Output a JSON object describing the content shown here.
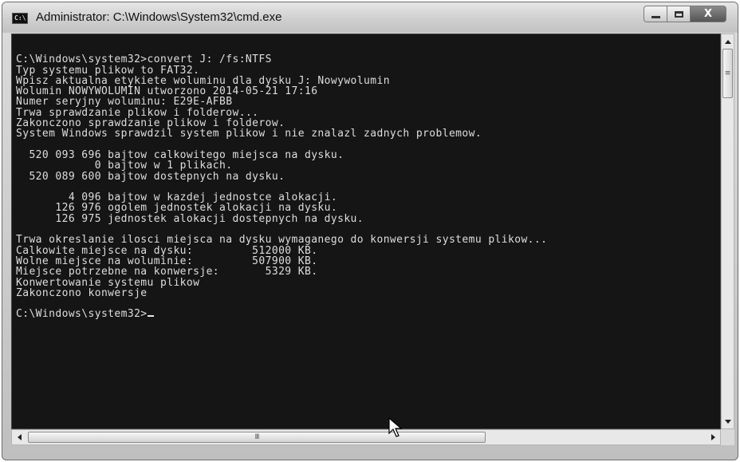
{
  "window": {
    "title": "Administrator: C:\\Windows\\System32\\cmd.exe",
    "icon": "cmd-icon",
    "controls": [
      "minimize-icon",
      "maximize-icon",
      "close-icon"
    ],
    "close_glyph": "X"
  },
  "console": {
    "lines": [
      "",
      "C:\\Windows\\system32>convert J: /fs:NTFS",
      "Typ systemu plikow to FAT32.",
      "Wpisz aktualna etykiete woluminu dla dysku J: Nowywolumin",
      "Wolumin NOWYWOLUMIN utworzono 2014-05-21 17:16",
      "Numer seryjny woluminu: E29E-AFBB",
      "Trwa sprawdzanie plikow i folderow...",
      "Zakonczono sprawdzanie plikow i folderow.",
      "System Windows sprawdzil system plikow i nie znalazl zadnych problemow.",
      "",
      "  520 093 696 bajtow calkowitego miejsca na dysku.",
      "            0 bajtow w 1 plikach.",
      "  520 089 600 bajtow dostepnych na dysku.",
      "",
      "        4 096 bajtow w kazdej jednostce alokacji.",
      "      126 976 ogolem jednostek alokacji na dysku.",
      "      126 975 jednostek alokacji dostepnych na dysku.",
      "",
      "Trwa okreslanie ilosci miejsca na dysku wymaganego do konwersji systemu plikow...",
      "Calkowite miejsce na dysku:         512000 KB.",
      "Wolne miejsce na woluminie:         507900 KB.",
      "Miejsce potrzebne na konwersje:       5329 KB.",
      "Konwertowanie systemu plikow",
      "Zakonczono konwersje",
      "",
      "C:\\Windows\\system32>"
    ]
  },
  "scrollbars": {
    "vertical_thumb_grip": "≡",
    "horizontal_thumb_grip": "III"
  }
}
